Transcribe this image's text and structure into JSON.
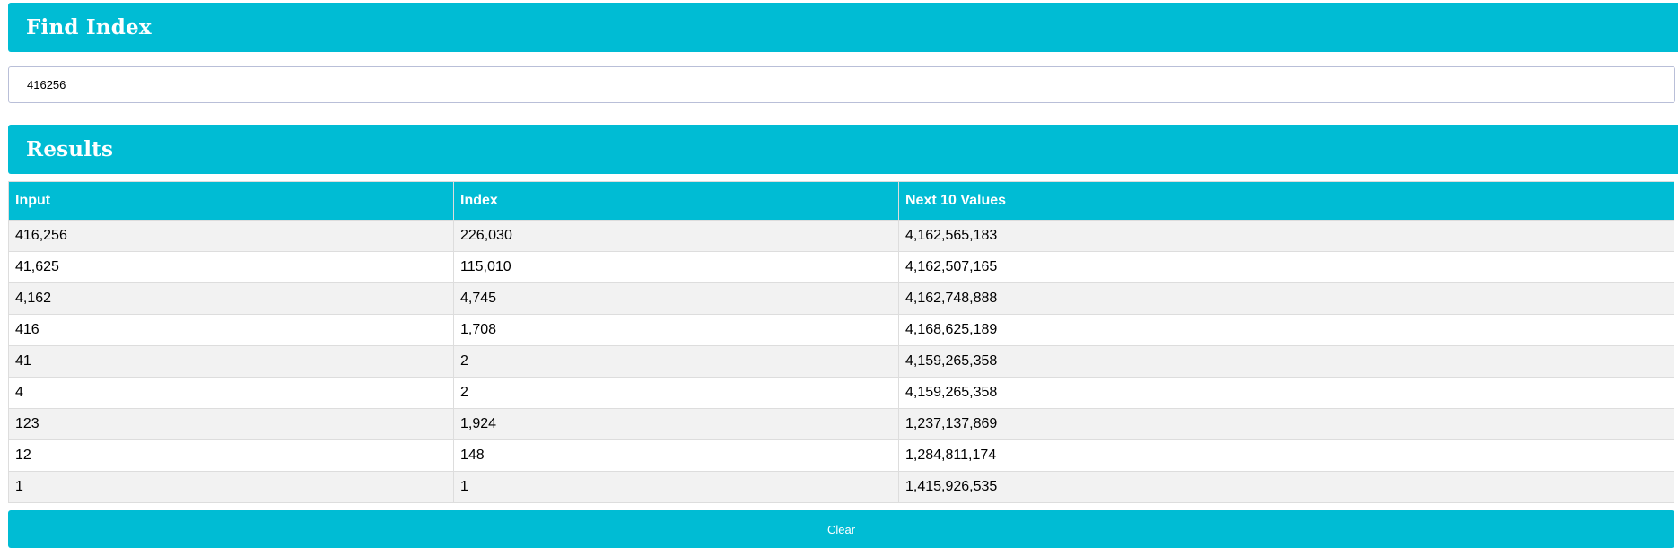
{
  "find_index": {
    "title": "Find Index",
    "input_value": "416256"
  },
  "results": {
    "title": "Results",
    "columns": [
      "Input",
      "Index",
      "Next 10 Values"
    ],
    "rows": [
      [
        "416,256",
        "226,030",
        "4,162,565,183"
      ],
      [
        "41,625",
        "115,010",
        "4,162,507,165"
      ],
      [
        "4,162",
        "4,745",
        "4,162,748,888"
      ],
      [
        "416",
        "1,708",
        "4,168,625,189"
      ],
      [
        "41",
        "2",
        "4,159,265,358"
      ],
      [
        "4",
        "2",
        "4,159,265,358"
      ],
      [
        "123",
        "1,924",
        "1,237,137,869"
      ],
      [
        "12",
        "148",
        "1,284,811,174"
      ],
      [
        "1",
        "1",
        "1,415,926,535"
      ]
    ]
  },
  "clear_button": {
    "label": "Clear"
  },
  "colors": {
    "accent": "#00bcd4",
    "row_alt": "#f2f2f2",
    "border": "#dddddd"
  }
}
